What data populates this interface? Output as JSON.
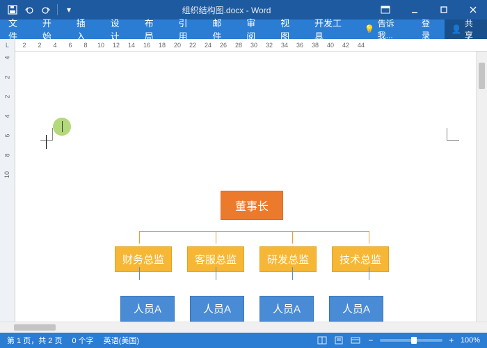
{
  "title": "组织结构图.docx - Word",
  "tabs": [
    "文件",
    "开始",
    "插入",
    "设计",
    "布局",
    "引用",
    "邮件",
    "审阅",
    "视图",
    "开发工具"
  ],
  "tellme": "告诉我...",
  "signin": "登录",
  "share": "共享",
  "ruler_corner": "L",
  "ruler_ticks": [
    "2",
    "2",
    "4",
    "6",
    "8",
    "10",
    "12",
    "14",
    "16",
    "18",
    "20",
    "22",
    "24",
    "26",
    "28",
    "30",
    "32",
    "34",
    "36",
    "38",
    "40",
    "42",
    "44"
  ],
  "v_ticks": [
    "4",
    "2",
    "2",
    "4",
    "6",
    "8",
    "10"
  ],
  "org": {
    "ceo": "董事长",
    "dirs": [
      "财务总监",
      "客服总监",
      "研发总监",
      "技术总监"
    ],
    "staff": [
      "人员A",
      "人员A",
      "人员A",
      "人员A"
    ]
  },
  "status": {
    "page": "第 1 页，共 2 页",
    "words": "0 个字",
    "lang": "英语(美国)"
  },
  "zoom": "100%"
}
